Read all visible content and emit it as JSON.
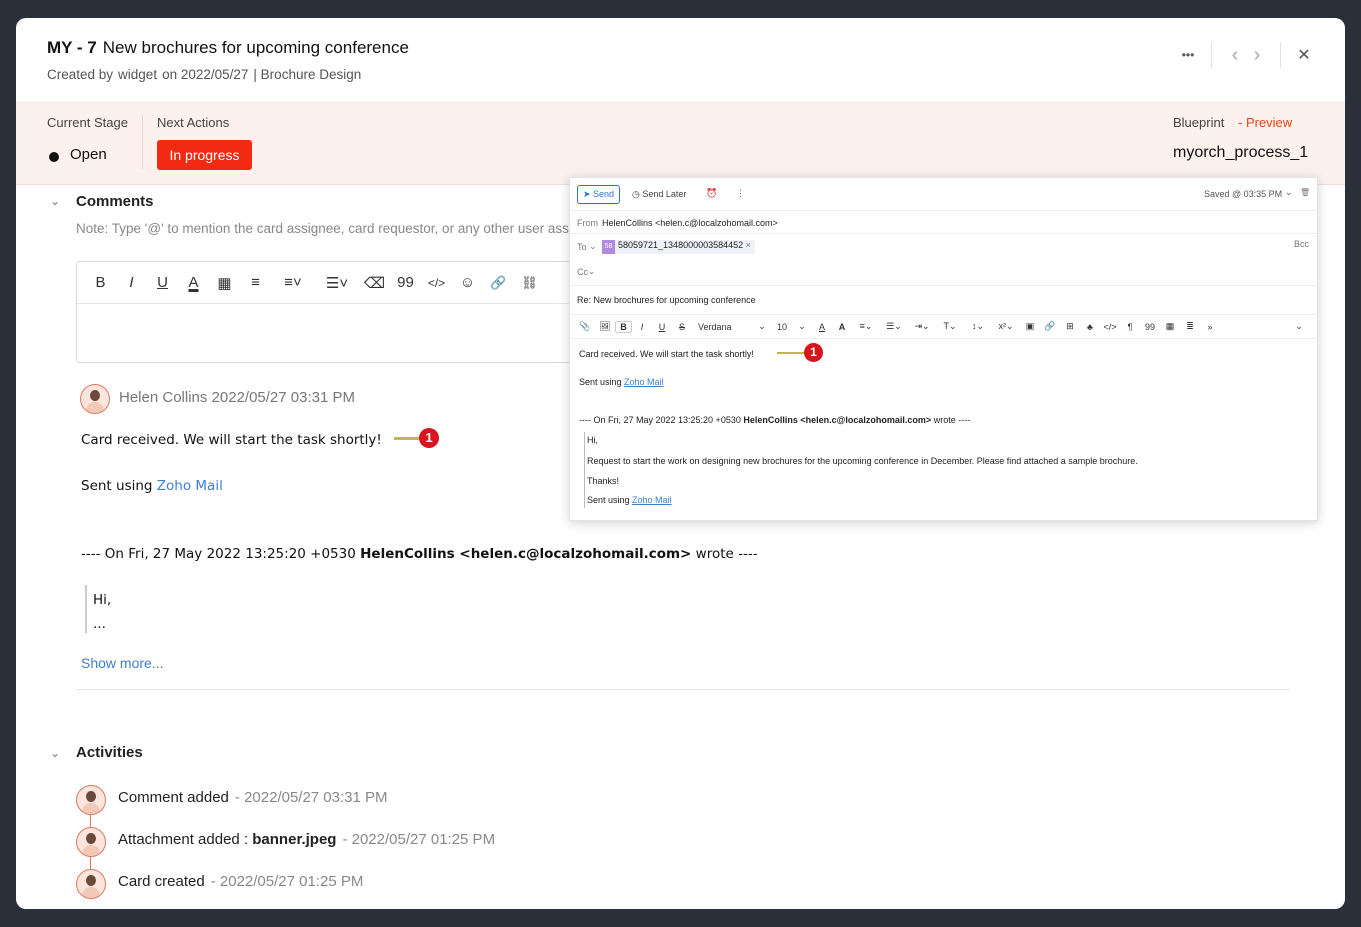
{
  "header": {
    "card_id": "MY - 7",
    "title": "New brochures for upcoming conference",
    "created_by_label": "Created by",
    "creator": "widget",
    "created_on": "on 2022/05/27",
    "category": "| Brochure Design",
    "more_icon": "•••",
    "prev_icon": "‹",
    "next_icon": "›",
    "close_icon": "✕"
  },
  "stage": {
    "current_label": "Current Stage",
    "current_value": "Open",
    "next_label": "Next Actions",
    "next_action_button": "In progress",
    "blueprint_label": "Blueprint",
    "preview_link": "- Preview",
    "blueprint_name": "myorch_process_1"
  },
  "comments": {
    "title": "Comments",
    "note": "Note: Type '@' to mention the card assignee, card requestor, or any other user ass",
    "toolbar": [
      "B",
      "I",
      "U",
      "A",
      "▦",
      "≡",
      "≡˅",
      "☰˅",
      "⌫",
      "99",
      "</>",
      "☺",
      "🔗",
      "⛓"
    ],
    "author": "Helen Collins",
    "timestamp": "2022/05/27 03:31 PM",
    "body_line1": "Card received. We will start the task shortly!",
    "callout": "1",
    "sent_using": "Sent using",
    "zoho_mail": "Zoho Mail",
    "quote_header_prefix": "---- On Fri, 27 May 2022 13:25:20 +0530",
    "quote_header_sender": "HelenCollins <helen.c@localzohomail.com>",
    "quote_header_suffix": "wrote ----",
    "quote_line1": "Hi,",
    "quote_line2": "...",
    "show_more": "Show more..."
  },
  "activities": {
    "title": "Activities",
    "items": [
      {
        "text": "Comment added",
        "bold": "",
        "time": "- 2022/05/27 03:31 PM"
      },
      {
        "text": "Attachment added :",
        "bold": "banner.jpeg",
        "time": "- 2022/05/27 01:25 PM"
      },
      {
        "text": "Card created",
        "bold": "",
        "time": "- 2022/05/27 01:25 PM"
      }
    ]
  },
  "mail": {
    "send_label": "Send",
    "send_later_label": "Send Later",
    "alarm_icon": "⏰",
    "more_icon": "⋮",
    "saved_label": "Saved @ 03:35 PM",
    "saved_chevron": "⌄",
    "trash_icon": "🗑",
    "from_label": "From",
    "from_value": "HelenCollins <helen.c@localzohomail.com>",
    "to_label": "To",
    "to_chip_initials": "58",
    "to_chip_value": "58059721_1348000003584452",
    "to_chip_remove": "×",
    "bcc_label": "Bcc",
    "cc_label": "Cc",
    "subject": "Re: New brochures for upcoming conference",
    "toolbar": [
      "📎",
      "🖼",
      "B",
      "I",
      "U",
      "S",
      "Verdana",
      "⌄",
      "10",
      "⌄",
      "A",
      "A",
      "≡⌄",
      "☰⌄",
      "⇥⌄",
      "T⌄",
      "↕⌄",
      "x²⌄",
      "▣",
      "🔗",
      "⊞",
      "♣",
      "</>",
      "¶",
      "99",
      "▦",
      "≣",
      "»"
    ],
    "body_line1": "Card received. We will start the task shortly!",
    "callout": "1",
    "sent_using": "Sent using",
    "zoho_mail": "Zoho Mail",
    "quote_prefix": "---- On Fri, 27 May 2022 13:25:20 +0530",
    "quote_sender": "HelenCollins <helen.c@localzohomail.com>",
    "quote_suffix": "wrote ----",
    "q_hi": "Hi,",
    "q_request": "Request to start the work on designing new brochures for the upcoming conference in December. Please find attached a sample brochure.",
    "q_thanks": "Thanks!",
    "q_sent_using": "Sent using",
    "q_zoho_mail": "Zoho Mail"
  }
}
